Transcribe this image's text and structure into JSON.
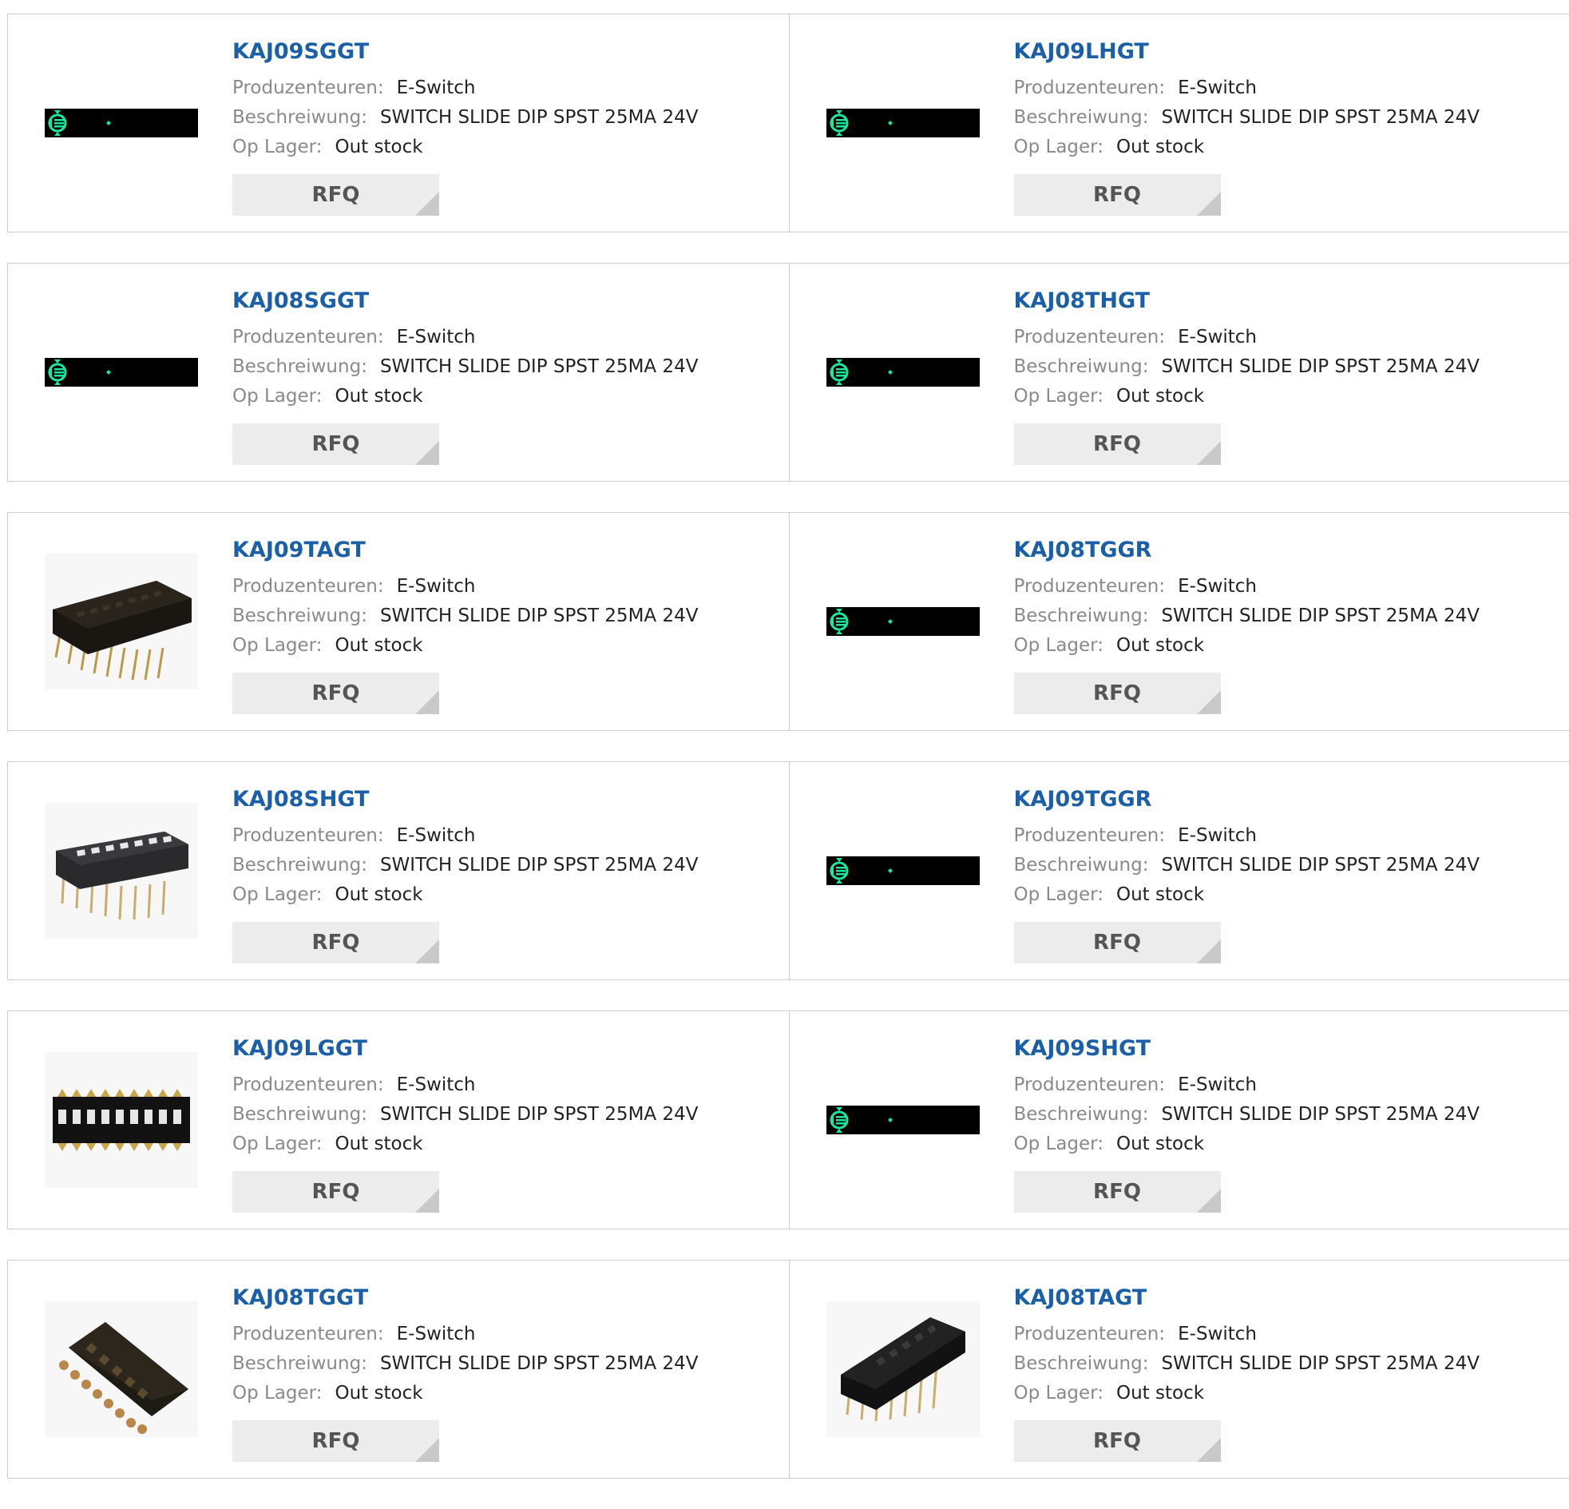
{
  "labels": {
    "manufacturer": "Produzenteuren:",
    "description": "Beschreiwung:",
    "stock": "Op Lager:",
    "rfq_button": "RFQ"
  },
  "colors": {
    "title_link": "#1a5fa8",
    "label": "#8a8a8a",
    "value": "#222222",
    "button_bg": "#ececec",
    "button_text": "#555555",
    "placeholder_icon": "#1be8a0"
  },
  "products": [
    {
      "part": "KAJ09SGGT",
      "manufacturer": "E-Switch",
      "description": "SWITCH SLIDE DIP SPST 25MA 24V",
      "stock": "Out stock",
      "image": "placeholder"
    },
    {
      "part": "KAJ09LHGT",
      "manufacturer": "E-Switch",
      "description": "SWITCH SLIDE DIP SPST 25MA 24V",
      "stock": "Out stock",
      "image": "placeholder"
    },
    {
      "part": "KAJ08SGGT",
      "manufacturer": "E-Switch",
      "description": "SWITCH SLIDE DIP SPST 25MA 24V",
      "stock": "Out stock",
      "image": "placeholder"
    },
    {
      "part": "KAJ08THGT",
      "manufacturer": "E-Switch",
      "description": "SWITCH SLIDE DIP SPST 25MA 24V",
      "stock": "Out stock",
      "image": "placeholder"
    },
    {
      "part": "KAJ09TAGT",
      "manufacturer": "E-Switch",
      "description": "SWITCH SLIDE DIP SPST 25MA 24V",
      "stock": "Out stock",
      "image": "dip-switch-angled-9pos"
    },
    {
      "part": "KAJ08TGGR",
      "manufacturer": "E-Switch",
      "description": "SWITCH SLIDE DIP SPST 25MA 24V",
      "stock": "Out stock",
      "image": "placeholder"
    },
    {
      "part": "KAJ08SHGT",
      "manufacturer": "E-Switch",
      "description": "SWITCH SLIDE DIP SPST 25MA 24V",
      "stock": "Out stock",
      "image": "dip-switch-angled-8pos"
    },
    {
      "part": "KAJ09TGGR",
      "manufacturer": "E-Switch",
      "description": "SWITCH SLIDE DIP SPST 25MA 24V",
      "stock": "Out stock",
      "image": "placeholder"
    },
    {
      "part": "KAJ09LGGT",
      "manufacturer": "E-Switch",
      "description": "SWITCH SLIDE DIP SPST 25MA 24V",
      "stock": "Out stock",
      "image": "dip-switch-top-9pos"
    },
    {
      "part": "KAJ09SHGT",
      "manufacturer": "E-Switch",
      "description": "SWITCH SLIDE DIP SPST 25MA 24V",
      "stock": "Out stock",
      "image": "placeholder"
    },
    {
      "part": "KAJ08TGGT",
      "manufacturer": "E-Switch",
      "description": "SWITCH SLIDE DIP SPST 25MA 24V",
      "stock": "Out stock",
      "image": "dip-switch-diagonal-8pos"
    },
    {
      "part": "KAJ08TAGT",
      "manufacturer": "E-Switch",
      "description": "SWITCH SLIDE DIP SPST 25MA 24V",
      "stock": "Out stock",
      "image": "dip-switch-diagonal-7pos"
    }
  ]
}
